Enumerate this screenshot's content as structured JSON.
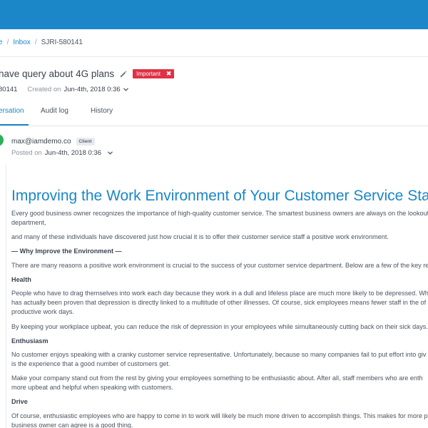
{
  "breadcrumb": {
    "home": "e",
    "inbox": "Inbox",
    "current": "SJRI-580141"
  },
  "ticket": {
    "title": "have query about 4G plans",
    "tag": "Important",
    "id": "80141",
    "created_label": "Created on",
    "created_date": "Jun-4th, 2018 0:36"
  },
  "tabs": [
    "ersation",
    "Audit log",
    "History"
  ],
  "message": {
    "sender": "max@iamdemo.co",
    "sender_badge": "Client",
    "posted_label": "Posted on",
    "posted_date": "Jun-4th, 2018 0:36"
  },
  "article": {
    "heading": "Improving the Work Environment of Your Customer Service Sta",
    "p1a": "Every good business owner recognizes the importance of high-quality customer service. The smartest business owners are always on the lookout",
    "p1b": "department,",
    "p2": "and many of these individuals have discovered just how crucial it is to offer their customer service staff a positive work environment.",
    "section": "— Why Improve the Environment —",
    "p3": "There are many reasons a positive work environment is crucial to the success of your customer service department. Below are a few of the key re",
    "h_health": "Health",
    "p4a": "People who have to drag themselves into work each day because they work in a dull and lifeless place are much more likely to be depressed. Wh",
    "p4b": "has actually been proven that depression is directly linked to a multitude of other illnesses. Of course, sick employees means fewer staff in the of",
    "p4c": "productive work days.",
    "p5": "By keeping your workplace upbeat, you can reduce the risk of depression in your employees while simultaneously cutting back on their sick days.",
    "h_enthusiasm": "Enthusiasm",
    "p6a": "No customer enjoys speaking with a cranky customer service representative. Unfortunately, because so many companies fail to put effort into giv",
    "p6b": "is the experience that a good number of customers get.",
    "p7a": "Make your company stand out from the rest by giving your employees something to be enthusiastic about. After all, staff members who are enth",
    "p7b": "more upbeat and helpful when speaking with customers.",
    "h_drive": "Drive",
    "p8a": "Of course, enthusiastic employees who are happy to come in to work will likely be much more driven to accomplish things. This makes for more p",
    "p8b": "business owner can agree is a good thing."
  }
}
